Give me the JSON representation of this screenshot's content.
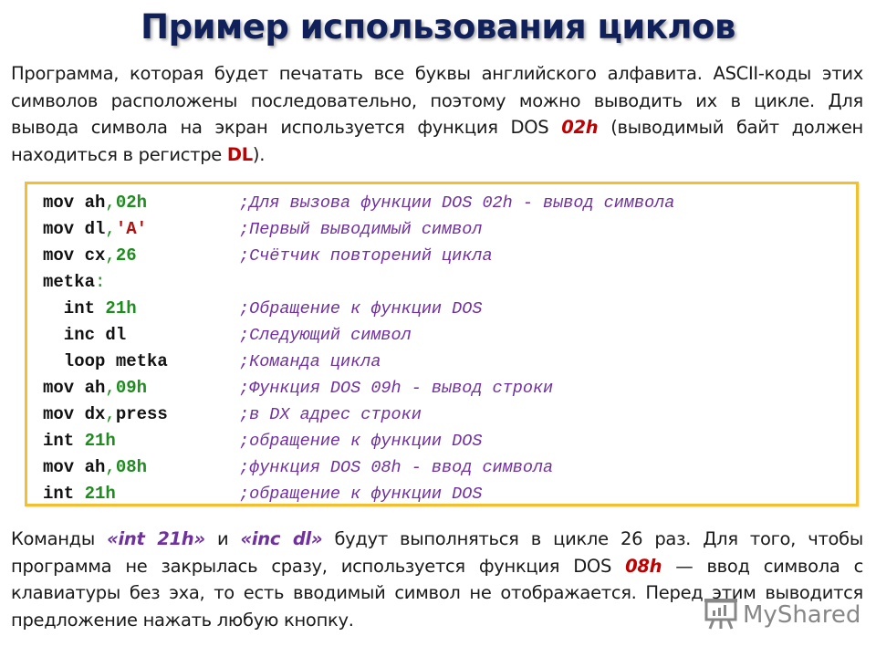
{
  "title": "Пример использования циклов",
  "intro": {
    "text_1": "Программа, которая будет печатать все буквы английского алфавита. ASCII-коды этих символов расположены последовательно, поэтому можно выводить их в цикле. Для вывода символа на экран используется функция DOS ",
    "highlight_1": "02h",
    "text_2": " (выводимый байт должен находиться в регистре ",
    "highlight_2": "DL",
    "text_3": ")."
  },
  "code": {
    "lines": [
      {
        "indent": "",
        "instr": "mov ah",
        "sep": ",",
        "arg": "02h",
        "arg_type": "num",
        "pad": "   ",
        "comment": ";Для вызова функции DOS 02h - вывод символа"
      },
      {
        "indent": "",
        "instr": "mov dl",
        "sep": ",",
        "arg": "'A'",
        "arg_type": "str",
        "pad": "   ",
        "comment": ";Первый выводимый символ"
      },
      {
        "indent": "",
        "instr": "mov cx",
        "sep": ",",
        "arg": "26",
        "arg_type": "num",
        "pad": "    ",
        "comment": ";Счётчик повторений цикла"
      },
      {
        "indent": "",
        "instr": "metka",
        "sep": ":",
        "arg": "",
        "arg_type": "num",
        "pad": "",
        "comment": ""
      },
      {
        "indent": "  ",
        "instr": "int ",
        "sep": "",
        "arg": "21h",
        "arg_type": "num",
        "pad": "    ",
        "comment": ";Обращение к функции DOS"
      },
      {
        "indent": "  ",
        "instr": "inc dl",
        "sep": "",
        "arg": "",
        "arg_type": "num",
        "pad": "",
        "comment": ";Следующий символ"
      },
      {
        "indent": "  ",
        "instr": "loop metka",
        "sep": "",
        "arg": "",
        "arg_type": "num",
        "pad": "",
        "comment": ";Команда цикла"
      },
      {
        "indent": "",
        "instr": "mov ah",
        "sep": ",",
        "arg": "09h",
        "arg_type": "num",
        "pad": "",
        "comment": ";Функция DOS 09h - вывод строки"
      },
      {
        "indent": "",
        "instr": "mov dx",
        "sep": ",",
        "arg": "press",
        "arg_type": "plain",
        "pad": "",
        "comment": ";в DX адрес строки"
      },
      {
        "indent": "",
        "instr": "int ",
        "sep": "",
        "arg": "21h",
        "arg_type": "num",
        "pad": "",
        "comment": ";обращение к функции DOS"
      },
      {
        "indent": "",
        "instr": "mov ah",
        "sep": ",",
        "arg": "08h",
        "arg_type": "num",
        "pad": "",
        "comment": ";функция DOS 08h - ввод символа"
      },
      {
        "indent": "",
        "instr": "int ",
        "sep": "",
        "arg": "21h",
        "arg_type": "num",
        "pad": "",
        "comment": ";обращение к функции DOS"
      }
    ]
  },
  "outro": {
    "text_1": "Команды ",
    "highlight_1": "«int 21h»",
    "text_2": " и ",
    "highlight_2": "«inc dl»",
    "text_3": " будут выполняться в цикле 26 раз. Для того, чтобы программа не закрылась сразу, используется функция DOS ",
    "highlight_3": "08h",
    "text_4": " — ввод символа с клавиатуры без эха, то есть вводимый символ не отображается. Перед этим выводится предложение нажать любую кнопку."
  },
  "watermark": {
    "text": "MyShared",
    "icon": "presentation-board-icon"
  },
  "colors": {
    "title": "#10205a",
    "highlight_red": "#c00000",
    "highlight_purple": "#7030a0",
    "code_number": "#1e8c1e",
    "code_string": "#b01010",
    "code_comment": "#7030a0",
    "code_border": "#f0c030"
  }
}
